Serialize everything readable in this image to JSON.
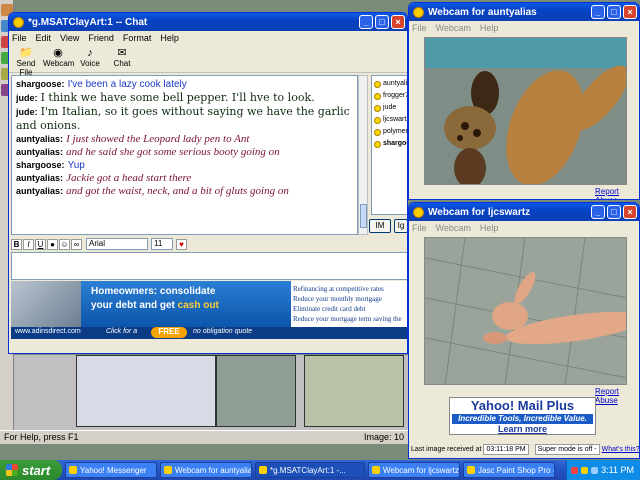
{
  "desktop": {
    "status_left": "For Help, press F1",
    "status_right": "Image: 10"
  },
  "chat": {
    "title": "*g.MSATClayArt:1 -- Chat",
    "menu": [
      "File",
      "Edit",
      "View",
      "Friend",
      "Format",
      "Help"
    ],
    "toolbar": [
      "Send File",
      "Webcam",
      "Voice",
      "Chat"
    ],
    "messages": [
      {
        "name": "shargoose:",
        "text": "I've been a lazy cook lately",
        "style": "blue"
      },
      {
        "name": "jude:",
        "text": "I think we have some bell pepper. I'll hve to look.",
        "style": "jude"
      },
      {
        "name": "jude:",
        "text": "I'm Italian, so it goes without saying we have the garlic and onions.",
        "style": "jude"
      },
      {
        "name": "auntyalias:",
        "text": "I just showed the Leopard lady pen to Ant",
        "style": "aunty"
      },
      {
        "name": "auntyalias:",
        "text": "and he said she got some serious booty going on",
        "style": "aunty"
      },
      {
        "name": "shargoose:",
        "text": "Yup",
        "style": "blue"
      },
      {
        "name": "auntyalias:",
        "text": "Jackie got a head start there",
        "style": "aunty"
      },
      {
        "name": "auntyalias:",
        "text": "and got the waist, neck, and a bit of gluts going on",
        "style": "aunty"
      }
    ],
    "buddies": [
      {
        "name": "auntyalias",
        "bold": false
      },
      {
        "name": "frogger703",
        "bold": false
      },
      {
        "name": "jude",
        "bold": false
      },
      {
        "name": "ljcswartz",
        "bold": false
      },
      {
        "name": "polymerfairy",
        "bold": false
      },
      {
        "name": "shargoose",
        "bold": true
      }
    ],
    "im_button": "IM",
    "ig_button": "Ig",
    "font_name": "Arial",
    "font_size": "11",
    "ad": {
      "headline1": "Homeowners: consolidate",
      "headline2a": "your debt and get ",
      "headline2b": "cash out",
      "bullets": [
        "Refinancing at competitive rates",
        "Reduce your monthly mortgage",
        "Eliminate credit card debt",
        "Reduce your mortgage term saving the"
      ],
      "url": "www.adinsdirect.com",
      "click_for": "Click for a",
      "free": "FREE",
      "quote": "no obligation quote"
    }
  },
  "webcam1": {
    "title": "Webcam for auntyalias",
    "menu": [
      "File",
      "Webcam",
      "Help"
    ],
    "report": "Report Abuse"
  },
  "webcam2": {
    "title": "Webcam for ljcswartz",
    "menu": [
      "File",
      "Webcam",
      "Help"
    ],
    "report": "Report Abuse",
    "ad_line1": "Yahoo! Mail Plus",
    "ad_line2": "Incredible Tools, Incredible Value.",
    "ad_line3": "Learn more",
    "status_label": "Last image received at",
    "status_time": "03:11:18 PM",
    "super_mode": "Super mode is off -",
    "whats_this": "What's this?"
  },
  "taskbar": {
    "start": "start",
    "tasks": [
      {
        "label": "Yahoo! Messenger",
        "active": false
      },
      {
        "label": "Webcam for auntyalias",
        "active": false
      },
      {
        "label": "*g.MSATClayArt:1 -...",
        "active": true
      },
      {
        "label": "Webcam for ljcswartz",
        "active": false
      },
      {
        "label": "Jasc Paint Shop Pro -...",
        "active": false
      }
    ],
    "clock": "3:11 PM"
  }
}
